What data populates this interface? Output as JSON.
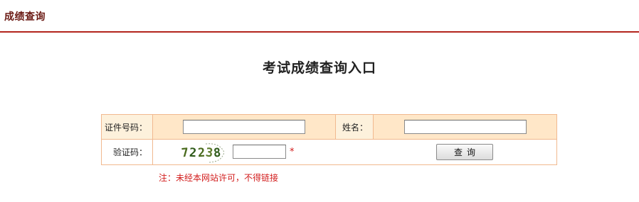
{
  "header": {
    "title": "成绩查询"
  },
  "main": {
    "heading": "考试成绩查询入口"
  },
  "form": {
    "id_label": "证件号码：",
    "id_value": "",
    "name_label": "姓名：",
    "name_value": "",
    "captcha_label": "验证码：",
    "captcha_chars": [
      "7",
      "2",
      "2",
      "3",
      "8"
    ],
    "captcha_value": "",
    "required_mark": "*",
    "submit_label": "查询"
  },
  "notice": "注：未经本网站许可，不得链接",
  "colors": {
    "accent": "#b3241c",
    "row_bg": "#ffe7c8",
    "warning": "#d21b1b"
  }
}
